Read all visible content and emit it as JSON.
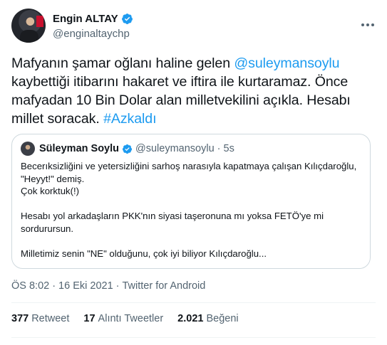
{
  "author": {
    "display_name": "Engin ALTAY",
    "handle": "@enginaltaychp"
  },
  "tweet": {
    "segments": [
      {
        "text": "Mafyanın şamar oğlanı haline gelen ",
        "type": "text"
      },
      {
        "text": "@suleymansoylu",
        "type": "mention"
      },
      {
        "text": " kaybettiği itibarını hakaret ve iftira ile kurtaramaz. Önce mafyadan 10 Bin Dolar alan milletvekilini açıkla.  Hesabı millet soracak. ",
        "type": "text"
      },
      {
        "text": "#Azkaldı",
        "type": "hashtag"
      }
    ]
  },
  "quoted": {
    "display_name": "Süleyman Soylu",
    "handle": "@suleymansoylu",
    "dot": "·",
    "time": "5s",
    "lines": [
      "Becerıksizliğini ve yetersizliğini sarhoş narasıyla kapatmaya çalışan Kılıçdaroğlu,",
      "\"Heyyt!\" demiş.",
      "Çok korktuk(!)",
      "",
      "Hesabı yol arkadaşların PKK'nın siyasi taşeronuna mı yoksa FETÖ'ye mi",
      "sordurursun.",
      "",
      "Milletimiz senin \"NE\" olduğunu, çok iyi biliyor Kılıçdaroğlu..."
    ]
  },
  "meta": {
    "time": "ÖS 8:02",
    "dot1": "·",
    "date": "16 Eki 2021",
    "dot2": "·",
    "source": "Twitter for Android"
  },
  "stats": {
    "retweets_count": "377",
    "retweets_label": "Retweet",
    "quotes_count": "17",
    "quotes_label": "Alıntı Tweetler",
    "likes_count": "2.021",
    "likes_label": "Beğeni"
  },
  "colors": {
    "link": "#1d9bf0",
    "secondary_text": "#536471",
    "border": "#cfd9de",
    "verified": "#1d9bf0"
  },
  "icons": [
    "verified-badge-icon",
    "more-options-icon"
  ]
}
